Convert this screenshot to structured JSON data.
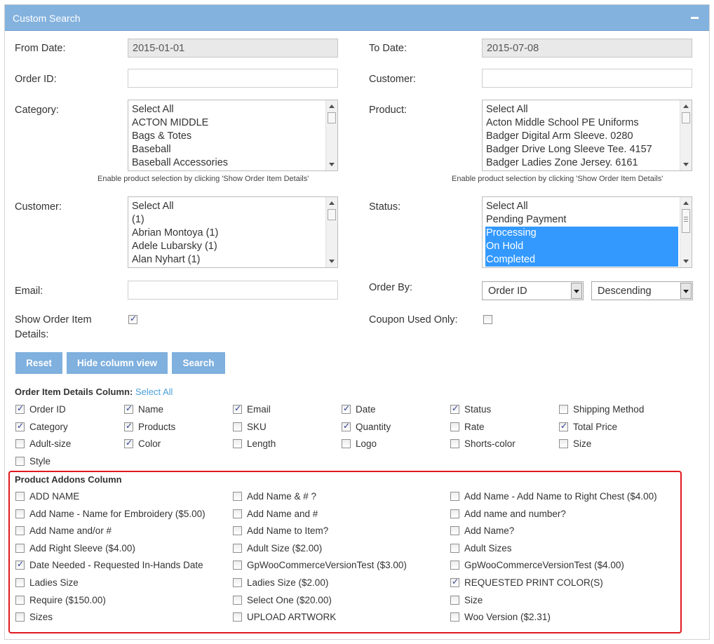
{
  "panel": {
    "title": "Custom Search"
  },
  "form": {
    "from_date_label": "From Date:",
    "from_date_value": "2015-01-01",
    "to_date_label": "To Date:",
    "to_date_value": "2015-07-08",
    "order_id_label": "Order ID:",
    "order_id_value": "",
    "customer_label": "Customer:",
    "customer_value": "",
    "category_label": "Category:",
    "category_options": [
      "Select All",
      "ACTON MIDDLE",
      "Bags & Totes",
      "Baseball",
      "Baseball Accessories"
    ],
    "category_hint": "Enable product selection by clicking 'Show Order Item Details'",
    "product_label": "Product:",
    "product_options": [
      "Select All",
      "Acton Middle School PE Uniforms",
      "Badger Digital Arm Sleeve. 0280",
      "Badger Drive Long Sleeve Tee. 4157",
      "Badger Ladies Zone Jersey. 6161"
    ],
    "product_hint": "Enable product selection by clicking 'Show Order Item Details'",
    "customer_list_label": "Customer:",
    "customer_options": [
      "Select All",
      "(1)",
      "Abrian Montoya (1)",
      "Adele Lubarsky (1)",
      "Alan Nyhart (1)"
    ],
    "status_label": "Status:",
    "status_options": [
      {
        "label": "Select All",
        "selected": false
      },
      {
        "label": "Pending Payment",
        "selected": false
      },
      {
        "label": "Processing",
        "selected": true
      },
      {
        "label": "On Hold",
        "selected": true
      },
      {
        "label": "Completed",
        "selected": true
      }
    ],
    "email_label": "Email:",
    "email_value": "",
    "order_by_label": "Order By:",
    "order_by_value": "Order ID",
    "order_dir_value": "Descending",
    "show_details_label_line1": "Show Order Item",
    "show_details_label_line2": "Details:",
    "show_details_checked": true,
    "coupon_label": "Coupon Used Only:",
    "coupon_checked": false
  },
  "buttons": {
    "reset": "Reset",
    "hide_columns": "Hide column view",
    "search": "Search"
  },
  "details_columns": {
    "title": "Order Item Details Column:",
    "select_all": "Select All",
    "items": [
      {
        "label": "Order ID",
        "checked": true
      },
      {
        "label": "Name",
        "checked": true
      },
      {
        "label": "Email",
        "checked": true
      },
      {
        "label": "Date",
        "checked": true
      },
      {
        "label": "Status",
        "checked": true
      },
      {
        "label": "Shipping Method",
        "checked": false
      },
      {
        "label": "Category",
        "checked": true
      },
      {
        "label": "Products",
        "checked": true
      },
      {
        "label": "SKU",
        "checked": false
      },
      {
        "label": "Quantity",
        "checked": true
      },
      {
        "label": "Rate",
        "checked": false
      },
      {
        "label": "Total Price",
        "checked": true
      },
      {
        "label": "Adult-size",
        "checked": false
      },
      {
        "label": "Color",
        "checked": true
      },
      {
        "label": "Length",
        "checked": false
      },
      {
        "label": "Logo",
        "checked": false
      },
      {
        "label": "Shorts-color",
        "checked": false
      },
      {
        "label": "Size",
        "checked": false
      },
      {
        "label": "Style",
        "checked": false
      }
    ]
  },
  "addons_columns": {
    "title": "Product Addons Column",
    "items": [
      {
        "label": "ADD NAME",
        "checked": false
      },
      {
        "label": "Add Name & # ?",
        "checked": false
      },
      {
        "label": "Add Name - Add Name to Right Chest ($4.00)",
        "checked": false
      },
      {
        "label": "Add Name - Name for Embroidery ($5.00)",
        "checked": false
      },
      {
        "label": "Add Name and #",
        "checked": false
      },
      {
        "label": "Add name and number?",
        "checked": false
      },
      {
        "label": "Add Name and/or #",
        "checked": false
      },
      {
        "label": "Add Name to Item?",
        "checked": false
      },
      {
        "label": "Add Name?",
        "checked": false
      },
      {
        "label": "Add Right Sleeve ($4.00)",
        "checked": false
      },
      {
        "label": "Adult Size ($2.00)",
        "checked": false
      },
      {
        "label": "Adult Sizes",
        "checked": false
      },
      {
        "label": "Date Needed - Requested In-Hands Date",
        "checked": true
      },
      {
        "label": "GpWooCommerceVersionTest ($3.00)",
        "checked": false
      },
      {
        "label": "GpWooCommerceVersionTest ($4.00)",
        "checked": false
      },
      {
        "label": "Ladies Size",
        "checked": false
      },
      {
        "label": "Ladies Size ($2.00)",
        "checked": false
      },
      {
        "label": "REQUESTED PRINT COLOR(S)",
        "checked": true
      },
      {
        "label": "Require ($150.00)",
        "checked": false
      },
      {
        "label": "Select One ($20.00)",
        "checked": false
      },
      {
        "label": "Size",
        "checked": false
      },
      {
        "label": "Sizes",
        "checked": false
      },
      {
        "label": "UPLOAD ARTWORK",
        "checked": false
      },
      {
        "label": "Woo Version ($2.31)",
        "checked": false
      }
    ]
  },
  "colors": {
    "header": "#84b2de",
    "button": "#7fb0de",
    "selection": "#3399ff",
    "highlight_frame": "#e0191f",
    "link": "#4a9fd8"
  }
}
